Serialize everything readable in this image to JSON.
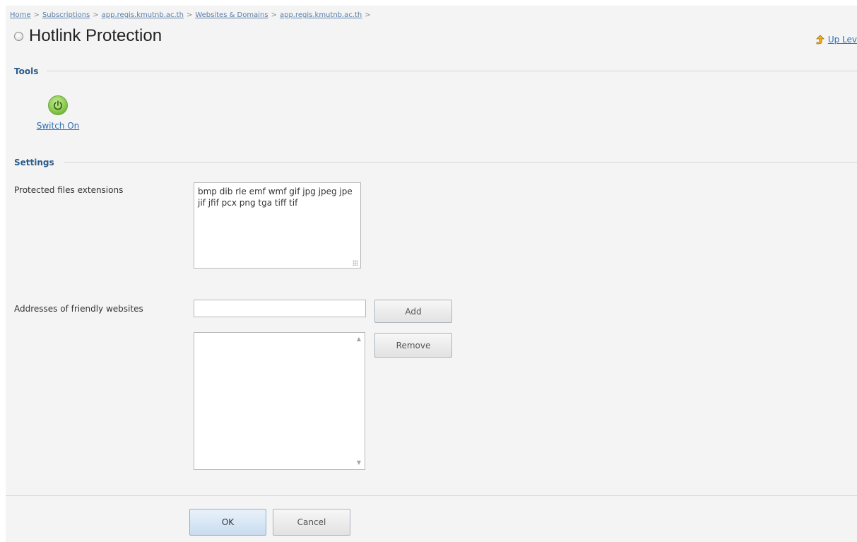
{
  "breadcrumb": {
    "items": [
      "Home",
      "Subscriptions",
      "app.regis.kmutnb.ac.th",
      "Websites & Domains",
      "app.regis.kmutnb.ac.th"
    ],
    "separator": ">"
  },
  "header": {
    "title": "Hotlink Protection",
    "up_level_label": "Up Lev"
  },
  "tools": {
    "heading": "Tools",
    "switch_on_label": "Switch On"
  },
  "settings": {
    "heading": "Settings",
    "protected_label": "Protected files extensions",
    "protected_value": "bmp dib rle emf wmf gif jpg jpeg jpe jif jfif pcx png tga tiff tif",
    "friendly_label": "Addresses of friendly websites",
    "friendly_input_value": "",
    "add_label": "Add",
    "remove_label": "Remove"
  },
  "footer": {
    "ok_label": "OK",
    "cancel_label": "Cancel"
  },
  "colors": {
    "link": "#2f6fb4",
    "section_heading": "#2a5b8a",
    "background": "#f4f4f4",
    "power_icon": "#8bcb4e"
  }
}
